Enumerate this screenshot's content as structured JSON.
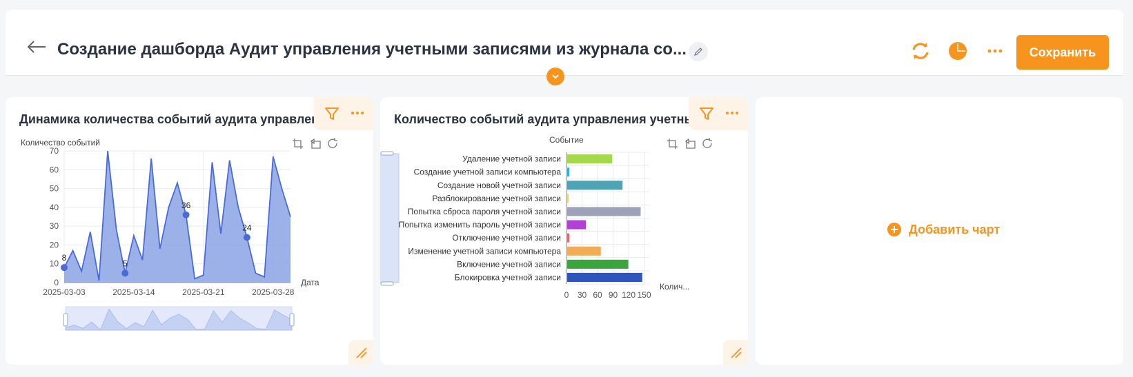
{
  "header": {
    "title": "Создание дашборда Аудит управления учетными записями из журнала со...",
    "save_label": "Сохранить",
    "icons": [
      "back-arrow-icon",
      "pencil-icon",
      "refresh-icon",
      "pie-icon",
      "more-icon",
      "chevron-down-icon"
    ]
  },
  "colors": {
    "accent": "#f7941d",
    "area": "#8ba3e4",
    "line": "#4a6bd6"
  },
  "card1": {
    "title": "Динамика количества событий аудита управлен"
  },
  "card2": {
    "title": "Количество событий аудита управления учетны"
  },
  "card3": {
    "add_label": "Добавить чарт"
  },
  "chart_data": [
    {
      "type": "area",
      "ylabel": "Количество событий",
      "xlabel": "Дата",
      "ylim": [
        0,
        70
      ],
      "yticks": [
        0,
        10,
        20,
        30,
        40,
        50,
        60,
        70
      ],
      "xticks": [
        "2025-03-03",
        "2025-03-14",
        "2025-03-21",
        "2025-03-28"
      ],
      "values": [
        8,
        17,
        6,
        27,
        1,
        70,
        28,
        5,
        25,
        12,
        66,
        18,
        40,
        53,
        36,
        2,
        4,
        64,
        26,
        65,
        40,
        24,
        5,
        3,
        67,
        50,
        35
      ],
      "labeled_points": [
        {
          "index": 0,
          "label": "8"
        },
        {
          "index": 7,
          "label": "5"
        },
        {
          "index": 14,
          "label": "36"
        },
        {
          "index": 21,
          "label": "24"
        }
      ]
    },
    {
      "type": "bar",
      "orientation": "horizontal",
      "ylabel": "Событие",
      "xlabel": "Колич...",
      "xticks": [
        "0",
        "30",
        "60",
        "90",
        "120",
        "150"
      ],
      "xmax": 160,
      "categories": [
        "Удаление учетной записи",
        "Создание учетной записи компьютера",
        "Создание новой учетной записи",
        "Разблокирование учетной записи",
        "Попытка сброса пароля учетной записи",
        "Попытка изменить пароль учетной записи",
        "Отключение учетной записи",
        "Изменение учетной записи компьютера",
        "Включение учетной записи",
        "Блокировка учетной записи"
      ],
      "values": [
        87,
        4,
        107,
        2,
        142,
        36,
        4,
        65,
        118,
        145
      ],
      "colors": [
        "#a3d94a",
        "#1fb5e6",
        "#4fa3b5",
        "#f2d34a",
        "#9ea2b8",
        "#b33fd9",
        "#e8636a",
        "#f2ac55",
        "#3aa53d",
        "#2f53bf"
      ]
    }
  ]
}
